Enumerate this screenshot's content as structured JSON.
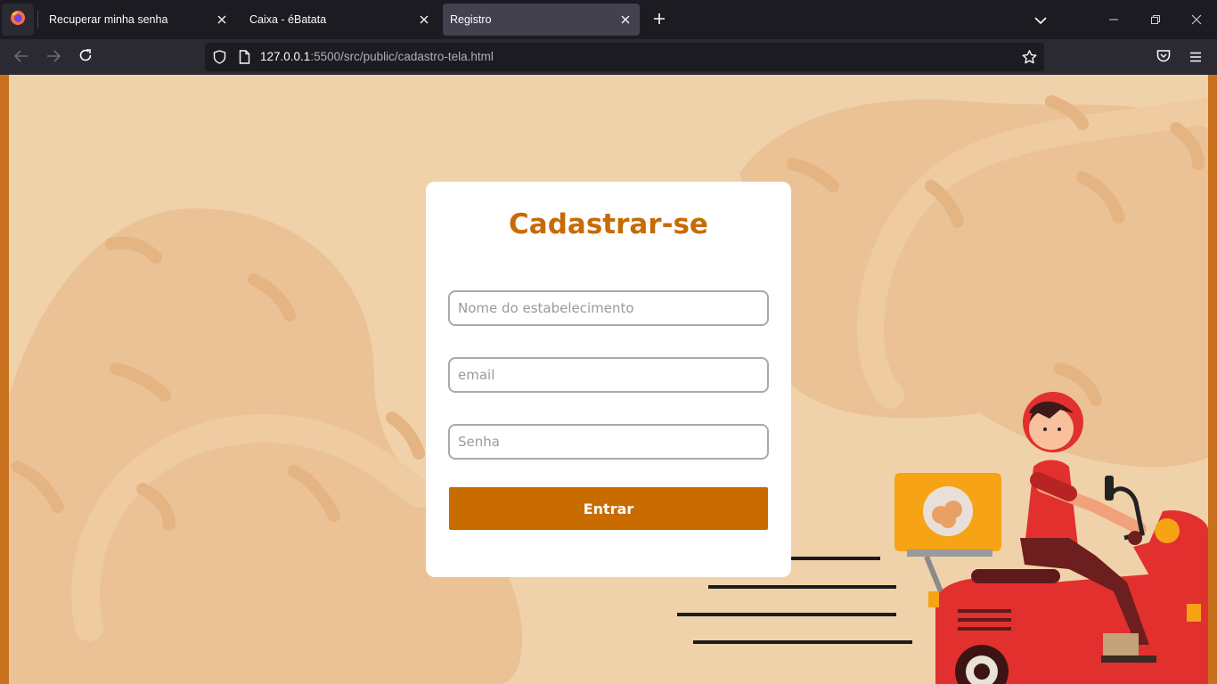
{
  "browser": {
    "tabs": [
      {
        "title": "Recuperar minha senha",
        "active": false
      },
      {
        "title": "Caixa - éBatata",
        "active": false
      },
      {
        "title": "Registro",
        "active": true
      }
    ],
    "url": {
      "host": "127.0.0.1",
      "rest": ":5500/src/public/cadastro-tela.html"
    },
    "icons": [
      "firefox-logo-icon",
      "close-icon",
      "new-tab-icon",
      "tab-list-icon",
      "minimize-icon",
      "restore-icon",
      "window-close-icon",
      "back-icon",
      "forward-icon",
      "reload-icon",
      "shield-icon",
      "page-icon",
      "bookmark-star-icon",
      "pocket-icon",
      "menu-icon"
    ]
  },
  "form": {
    "title": "Cadastrar-se",
    "fields": [
      {
        "placeholder": "Nome do estabelecimento",
        "value": ""
      },
      {
        "placeholder": "email",
        "value": ""
      },
      {
        "placeholder": "Senha",
        "value": ""
      }
    ],
    "submit_label": "Entrar"
  },
  "colors": {
    "accent": "#c96c00",
    "title": "#c76b06",
    "background": "#f0d2aa",
    "frame": "#c8701c"
  }
}
